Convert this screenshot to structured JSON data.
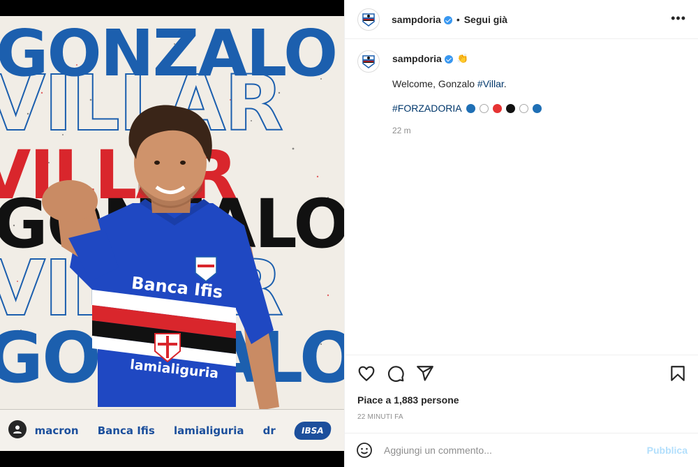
{
  "post": {
    "username": "sampdoria",
    "follow_label": "Segui già",
    "dot": "•",
    "more_label": "•••",
    "caption_user": "sampdoria",
    "caption_text": "Welcome, Gonzalo ",
    "caption_tag": "#Villar",
    "caption_end": ".",
    "hashtag": "#FORZADORIA",
    "color_circles": [
      "#1f6fb5",
      "#ffffff",
      "#e63333",
      "#111111",
      "#ffffff",
      "#1f6fb5"
    ],
    "time": "22 m",
    "likes": "Piace a 1,883 persone",
    "ago": "22 MINUTI FA",
    "comment_placeholder": "Aggiungi un commento...",
    "publish_label": "Pubblica"
  },
  "media": {
    "word_top": "GONZALO",
    "word_villar": "VILLAR",
    "word_gonzalo": "GONZALO",
    "jersey_sponsor": "Banca Ifis",
    "jersey_bottom": "lamialiguria",
    "sponsors": [
      "macron",
      "Banca Ifis",
      "lamialiguria",
      "dr",
      "IBSA"
    ]
  },
  "colors": {
    "brand_blue": "#1c5fae",
    "accent_red": "#d9262c",
    "link": "#00376b",
    "publish": "#b2dffc",
    "verified": "#3897f0"
  }
}
